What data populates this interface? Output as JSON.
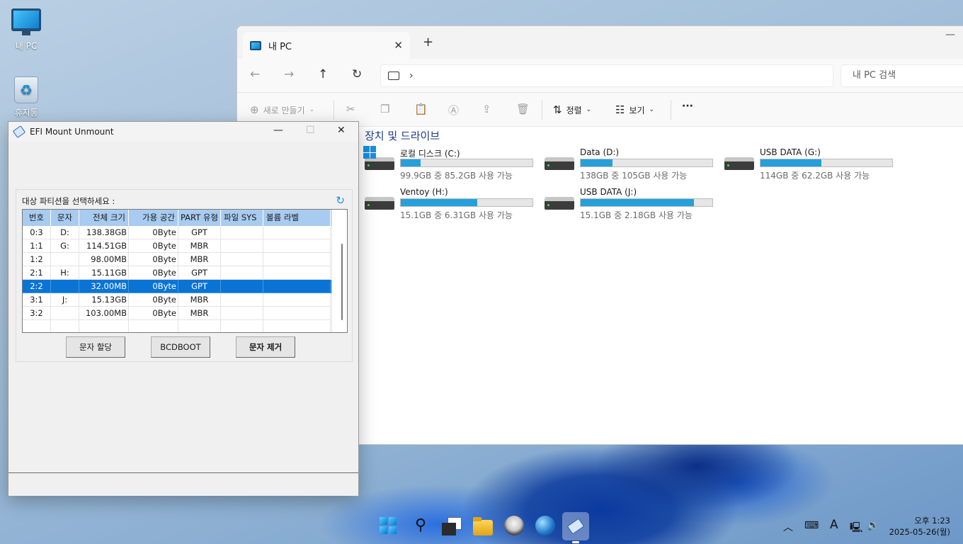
{
  "desktop": {
    "icons": [
      {
        "label": "내 PC"
      },
      {
        "label": "휴지통"
      }
    ]
  },
  "explorer": {
    "tab_title": "내 PC",
    "address_chevron": "›",
    "search_placeholder": "내 PC 검색",
    "toolbar": {
      "new_label": "새로 만들기",
      "sort_label": "정렬",
      "view_label": "보기",
      "more_label": "···"
    },
    "section_title": "장치 및 드라이브",
    "drives": [
      {
        "name": "로컬 디스크 (C:)",
        "detail": "99.9GB 중 85.2GB 사용 가능",
        "used_fraction": 0.15
      },
      {
        "name": "Data (D:)",
        "detail": "138GB 중 105GB 사용 가능",
        "used_fraction": 0.24
      },
      {
        "name": "USB DATA (G:)",
        "detail": "114GB 중 62.2GB 사용 가능",
        "used_fraction": 0.46
      },
      {
        "name": "Ventoy (H:)",
        "detail": "15.1GB 중 6.31GB 사용 가능",
        "used_fraction": 0.58
      },
      {
        "name": "USB DATA (J:)",
        "detail": "15.1GB 중 2.18GB 사용 가능",
        "used_fraction": 0.86
      }
    ]
  },
  "efi": {
    "title": "EFI Mount Unmount",
    "group_label": "대상 파티션을 선택하세요 :",
    "columns": [
      "번호",
      "문자",
      "전체 크기",
      "가용 공간",
      "PART 유형",
      "파일 SYS",
      "볼륨 라벨"
    ],
    "rows": [
      [
        "0:3",
        "D:",
        "138.38GB",
        "0Byte",
        "GPT",
        "",
        ""
      ],
      [
        "1:1",
        "G:",
        "114.51GB",
        "0Byte",
        "MBR",
        "",
        ""
      ],
      [
        "1:2",
        "",
        "98.00MB",
        "0Byte",
        "MBR",
        "",
        ""
      ],
      [
        "2:1",
        "H:",
        "15.11GB",
        "0Byte",
        "GPT",
        "",
        ""
      ],
      [
        "2:2",
        "",
        "32.00MB",
        "0Byte",
        "GPT",
        "",
        ""
      ],
      [
        "3:1",
        "J:",
        "15.13GB",
        "0Byte",
        "MBR",
        "",
        ""
      ],
      [
        "3:2",
        "",
        "103.00MB",
        "0Byte",
        "MBR",
        "",
        ""
      ],
      [
        "",
        "",
        "",
        "",
        "",
        "",
        ""
      ]
    ],
    "selected_row": 4,
    "buttons": {
      "assign": "문자 할당",
      "bcdboot": "BCDBOOT",
      "remove": "문자 제거"
    }
  },
  "taskbar": {
    "time": "오후 1:23",
    "date": "2025-05-26(월)",
    "ime": "A"
  }
}
